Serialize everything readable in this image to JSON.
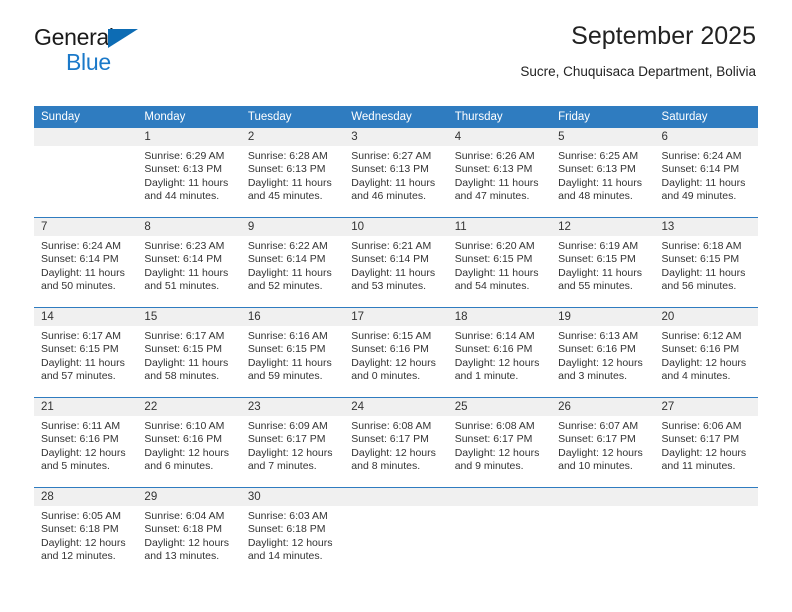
{
  "brand": {
    "name_top": "General",
    "name_bottom": "Blue",
    "accent_color": "#1b79c9",
    "triangle_color": "#0d6cb4"
  },
  "header": {
    "title": "September 2025",
    "subtitle": "Sucre, Chuquisaca Department, Bolivia"
  },
  "calendar": {
    "header_color": "#2f7cc0",
    "daynum_background": "#f0f0f0",
    "weekdays": [
      "Sunday",
      "Monday",
      "Tuesday",
      "Wednesday",
      "Thursday",
      "Friday",
      "Saturday"
    ],
    "weeks": [
      [
        {
          "day": "",
          "sunrise": "",
          "sunset": "",
          "daylight1": "",
          "daylight2": ""
        },
        {
          "day": "1",
          "sunrise": "Sunrise: 6:29 AM",
          "sunset": "Sunset: 6:13 PM",
          "daylight1": "Daylight: 11 hours",
          "daylight2": "and 44 minutes."
        },
        {
          "day": "2",
          "sunrise": "Sunrise: 6:28 AM",
          "sunset": "Sunset: 6:13 PM",
          "daylight1": "Daylight: 11 hours",
          "daylight2": "and 45 minutes."
        },
        {
          "day": "3",
          "sunrise": "Sunrise: 6:27 AM",
          "sunset": "Sunset: 6:13 PM",
          "daylight1": "Daylight: 11 hours",
          "daylight2": "and 46 minutes."
        },
        {
          "day": "4",
          "sunrise": "Sunrise: 6:26 AM",
          "sunset": "Sunset: 6:13 PM",
          "daylight1": "Daylight: 11 hours",
          "daylight2": "and 47 minutes."
        },
        {
          "day": "5",
          "sunrise": "Sunrise: 6:25 AM",
          "sunset": "Sunset: 6:13 PM",
          "daylight1": "Daylight: 11 hours",
          "daylight2": "and 48 minutes."
        },
        {
          "day": "6",
          "sunrise": "Sunrise: 6:24 AM",
          "sunset": "Sunset: 6:14 PM",
          "daylight1": "Daylight: 11 hours",
          "daylight2": "and 49 minutes."
        }
      ],
      [
        {
          "day": "7",
          "sunrise": "Sunrise: 6:24 AM",
          "sunset": "Sunset: 6:14 PM",
          "daylight1": "Daylight: 11 hours",
          "daylight2": "and 50 minutes."
        },
        {
          "day": "8",
          "sunrise": "Sunrise: 6:23 AM",
          "sunset": "Sunset: 6:14 PM",
          "daylight1": "Daylight: 11 hours",
          "daylight2": "and 51 minutes."
        },
        {
          "day": "9",
          "sunrise": "Sunrise: 6:22 AM",
          "sunset": "Sunset: 6:14 PM",
          "daylight1": "Daylight: 11 hours",
          "daylight2": "and 52 minutes."
        },
        {
          "day": "10",
          "sunrise": "Sunrise: 6:21 AM",
          "sunset": "Sunset: 6:14 PM",
          "daylight1": "Daylight: 11 hours",
          "daylight2": "and 53 minutes."
        },
        {
          "day": "11",
          "sunrise": "Sunrise: 6:20 AM",
          "sunset": "Sunset: 6:15 PM",
          "daylight1": "Daylight: 11 hours",
          "daylight2": "and 54 minutes."
        },
        {
          "day": "12",
          "sunrise": "Sunrise: 6:19 AM",
          "sunset": "Sunset: 6:15 PM",
          "daylight1": "Daylight: 11 hours",
          "daylight2": "and 55 minutes."
        },
        {
          "day": "13",
          "sunrise": "Sunrise: 6:18 AM",
          "sunset": "Sunset: 6:15 PM",
          "daylight1": "Daylight: 11 hours",
          "daylight2": "and 56 minutes."
        }
      ],
      [
        {
          "day": "14",
          "sunrise": "Sunrise: 6:17 AM",
          "sunset": "Sunset: 6:15 PM",
          "daylight1": "Daylight: 11 hours",
          "daylight2": "and 57 minutes."
        },
        {
          "day": "15",
          "sunrise": "Sunrise: 6:17 AM",
          "sunset": "Sunset: 6:15 PM",
          "daylight1": "Daylight: 11 hours",
          "daylight2": "and 58 minutes."
        },
        {
          "day": "16",
          "sunrise": "Sunrise: 6:16 AM",
          "sunset": "Sunset: 6:15 PM",
          "daylight1": "Daylight: 11 hours",
          "daylight2": "and 59 minutes."
        },
        {
          "day": "17",
          "sunrise": "Sunrise: 6:15 AM",
          "sunset": "Sunset: 6:16 PM",
          "daylight1": "Daylight: 12 hours",
          "daylight2": "and 0 minutes."
        },
        {
          "day": "18",
          "sunrise": "Sunrise: 6:14 AM",
          "sunset": "Sunset: 6:16 PM",
          "daylight1": "Daylight: 12 hours",
          "daylight2": "and 1 minute."
        },
        {
          "day": "19",
          "sunrise": "Sunrise: 6:13 AM",
          "sunset": "Sunset: 6:16 PM",
          "daylight1": "Daylight: 12 hours",
          "daylight2": "and 3 minutes."
        },
        {
          "day": "20",
          "sunrise": "Sunrise: 6:12 AM",
          "sunset": "Sunset: 6:16 PM",
          "daylight1": "Daylight: 12 hours",
          "daylight2": "and 4 minutes."
        }
      ],
      [
        {
          "day": "21",
          "sunrise": "Sunrise: 6:11 AM",
          "sunset": "Sunset: 6:16 PM",
          "daylight1": "Daylight: 12 hours",
          "daylight2": "and 5 minutes."
        },
        {
          "day": "22",
          "sunrise": "Sunrise: 6:10 AM",
          "sunset": "Sunset: 6:16 PM",
          "daylight1": "Daylight: 12 hours",
          "daylight2": "and 6 minutes."
        },
        {
          "day": "23",
          "sunrise": "Sunrise: 6:09 AM",
          "sunset": "Sunset: 6:17 PM",
          "daylight1": "Daylight: 12 hours",
          "daylight2": "and 7 minutes."
        },
        {
          "day": "24",
          "sunrise": "Sunrise: 6:08 AM",
          "sunset": "Sunset: 6:17 PM",
          "daylight1": "Daylight: 12 hours",
          "daylight2": "and 8 minutes."
        },
        {
          "day": "25",
          "sunrise": "Sunrise: 6:08 AM",
          "sunset": "Sunset: 6:17 PM",
          "daylight1": "Daylight: 12 hours",
          "daylight2": "and 9 minutes."
        },
        {
          "day": "26",
          "sunrise": "Sunrise: 6:07 AM",
          "sunset": "Sunset: 6:17 PM",
          "daylight1": "Daylight: 12 hours",
          "daylight2": "and 10 minutes."
        },
        {
          "day": "27",
          "sunrise": "Sunrise: 6:06 AM",
          "sunset": "Sunset: 6:17 PM",
          "daylight1": "Daylight: 12 hours",
          "daylight2": "and 11 minutes."
        }
      ],
      [
        {
          "day": "28",
          "sunrise": "Sunrise: 6:05 AM",
          "sunset": "Sunset: 6:18 PM",
          "daylight1": "Daylight: 12 hours",
          "daylight2": "and 12 minutes."
        },
        {
          "day": "29",
          "sunrise": "Sunrise: 6:04 AM",
          "sunset": "Sunset: 6:18 PM",
          "daylight1": "Daylight: 12 hours",
          "daylight2": "and 13 minutes."
        },
        {
          "day": "30",
          "sunrise": "Sunrise: 6:03 AM",
          "sunset": "Sunset: 6:18 PM",
          "daylight1": "Daylight: 12 hours",
          "daylight2": "and 14 minutes."
        },
        {
          "day": "",
          "sunrise": "",
          "sunset": "",
          "daylight1": "",
          "daylight2": ""
        },
        {
          "day": "",
          "sunrise": "",
          "sunset": "",
          "daylight1": "",
          "daylight2": ""
        },
        {
          "day": "",
          "sunrise": "",
          "sunset": "",
          "daylight1": "",
          "daylight2": ""
        },
        {
          "day": "",
          "sunrise": "",
          "sunset": "",
          "daylight1": "",
          "daylight2": ""
        }
      ]
    ]
  }
}
